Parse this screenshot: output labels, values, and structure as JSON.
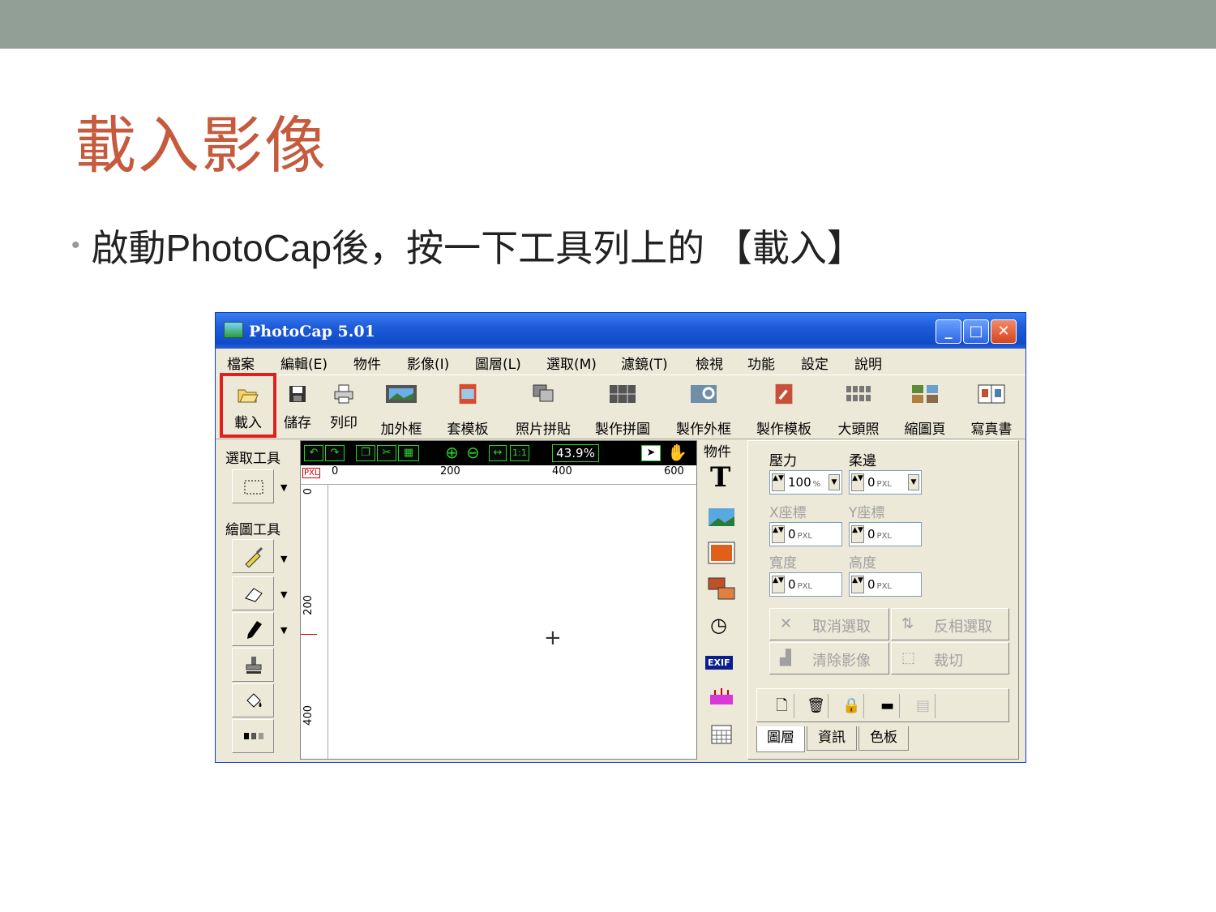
{
  "slide": {
    "title": "載入影像",
    "bullet": "啟動PhotoCap後，按一下工具列上的 【載入】"
  },
  "window": {
    "title": "PhotoCap 5.01",
    "controls": {
      "minimize": "_",
      "maximize": "□",
      "close": "✕"
    }
  },
  "menu": [
    "檔案",
    "編輯(E)",
    "物件",
    "影像(I)",
    "圖層(L)",
    "選取(M)",
    "濾鏡(T)",
    "檢視",
    "功能",
    "設定",
    "說明"
  ],
  "toolbar": [
    "載入",
    "儲存",
    "列印",
    "加外框",
    "套模板",
    "照片拼貼",
    "製作拼圖",
    "製作外框",
    "製作模板",
    "大頭照",
    "縮圖頁",
    "寫真書"
  ],
  "left_panel": {
    "select_label": "選取工具",
    "draw_label": "繪圖工具"
  },
  "canvas": {
    "zoom": "43.9%",
    "unit": "PXL",
    "ruler_top": [
      "0",
      "200",
      "400",
      "600"
    ],
    "ruler_left": [
      "0",
      "200",
      "400"
    ],
    "zoom_fit": "↔",
    "zoom_1to1": "1:1"
  },
  "object_panel": {
    "label": "物件",
    "text_tool": "T",
    "exif": "EXIF"
  },
  "right_panel": {
    "pressure_label": "壓力",
    "pressure_value": "100",
    "pressure_unit": "%",
    "soft_label": "柔邊",
    "soft_value": "0",
    "x_label": "X座標",
    "x_value": "0",
    "y_label": "Y座標",
    "y_value": "0",
    "width_label": "寬度",
    "width_value": "0",
    "height_label": "高度",
    "height_value": "0",
    "unit": "PXL",
    "cancel_select": "取消選取",
    "invert_select": "反相選取",
    "clear_image": "清除影像",
    "crop": "裁切",
    "tabs": [
      "圖層",
      "資訊",
      "色板"
    ]
  },
  "colors": {
    "highlight": "#e02020",
    "title_red": "#c55a3c",
    "titlebar": "#1e5bd9",
    "canvas_toolbar": "#000000",
    "accent_green": "#2bd12b"
  }
}
